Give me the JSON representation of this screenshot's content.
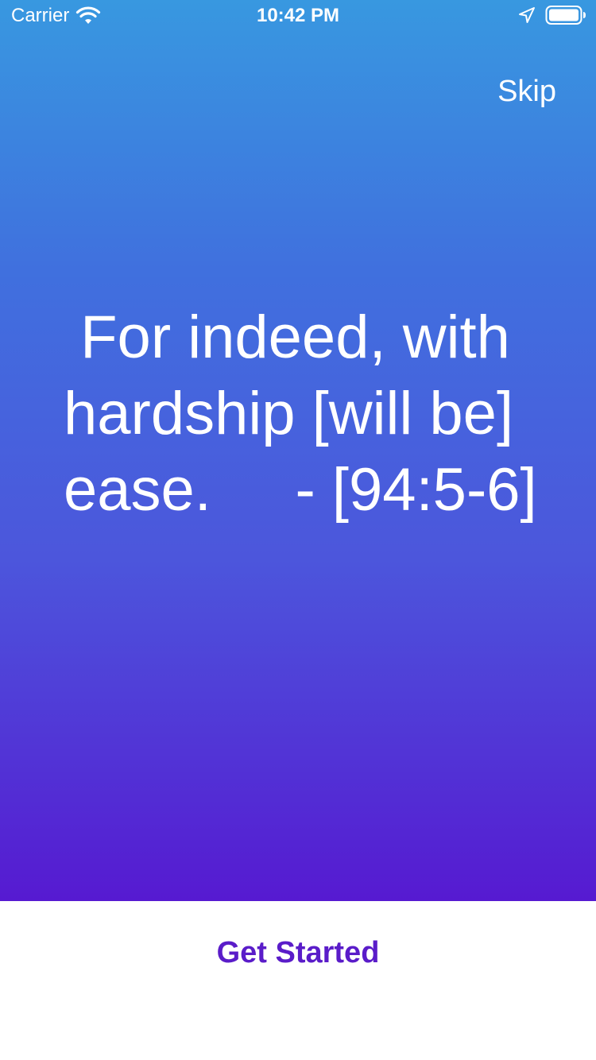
{
  "status_bar": {
    "carrier": "Carrier",
    "time": "10:42 PM",
    "icons": [
      "wifi-icon",
      "location-icon",
      "battery-icon"
    ]
  },
  "header": {
    "skip_label": "Skip"
  },
  "quote": {
    "text": " For indeed, with hardship [will be] ease.     - [94:5-6]"
  },
  "footer": {
    "get_started_label": "Get Started"
  },
  "colors": {
    "gradient_top": "#3898e0",
    "gradient_bottom": "#561ad1",
    "accent": "#5a1cc9",
    "background": "#ffffff"
  }
}
